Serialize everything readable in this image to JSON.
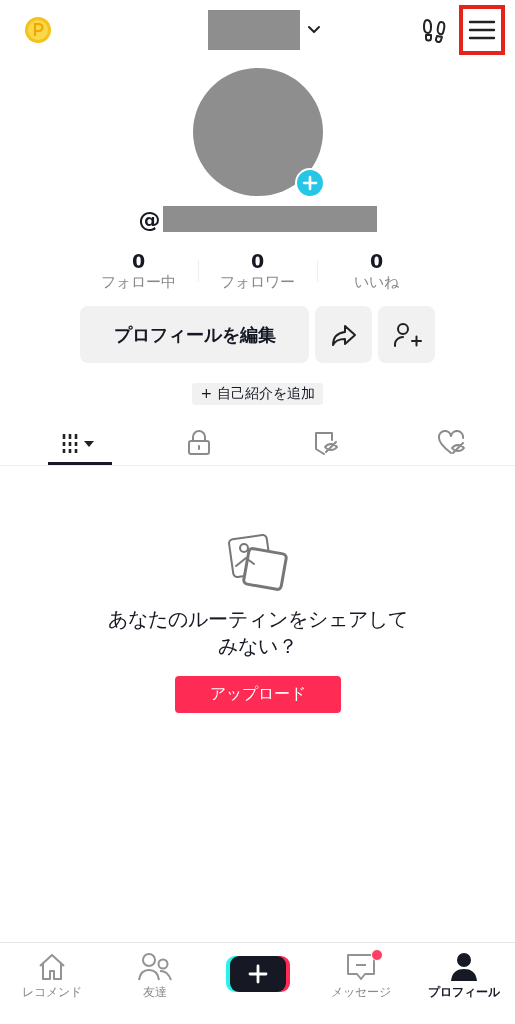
{
  "header": {
    "menu_highlighted": true
  },
  "username_prefix": "@",
  "stats": [
    {
      "value": "0",
      "label": "フォロー中"
    },
    {
      "value": "0",
      "label": "フォロワー"
    },
    {
      "value": "0",
      "label": "いいね"
    }
  ],
  "edit_button": "プロフィールを編集",
  "bio_chip": "+ 自己紹介を追加",
  "tabs": [
    {
      "kind": "grid",
      "selected": true
    },
    {
      "kind": "lock",
      "selected": false
    },
    {
      "kind": "bookmark",
      "selected": false
    },
    {
      "kind": "heart",
      "selected": false
    }
  ],
  "empty_state": {
    "message": "あなたのルーティンをシェアしてみない？",
    "button": "アップロード"
  },
  "nav": [
    {
      "kind": "home",
      "label": "レコメンド",
      "selected": false,
      "badge": false
    },
    {
      "kind": "friends",
      "label": "友達",
      "selected": false,
      "badge": false
    },
    {
      "kind": "create"
    },
    {
      "kind": "inbox",
      "label": "メッセージ",
      "selected": false,
      "badge": true
    },
    {
      "kind": "profile",
      "label": "プロフィール",
      "selected": true,
      "badge": false
    }
  ]
}
